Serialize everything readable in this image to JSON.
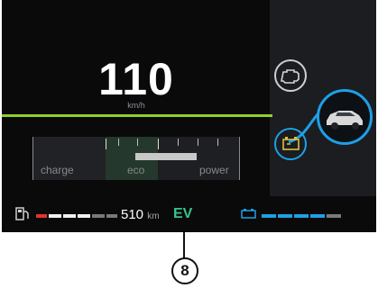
{
  "speed": {
    "value": "110",
    "unit": "km/h"
  },
  "gauge": {
    "labels": {
      "charge": "charge",
      "eco": "eco",
      "power": "power"
    }
  },
  "energy_flow": {
    "icons": [
      "engine-icon",
      "car-icon",
      "battery-icon"
    ],
    "flow_color": "#1ea0e6"
  },
  "status_bar": {
    "fuel_icon": "fuel-pump-icon",
    "range_value": "510",
    "range_unit": "km",
    "mode": "EV",
    "mode_color": "#35c58a",
    "battery_icon": "battery-icon"
  },
  "callout": {
    "number": "8"
  },
  "colors": {
    "accent_green": "#8fd12a",
    "accent_blue": "#1ea0e6",
    "fuel_warning": "#e0332e"
  }
}
